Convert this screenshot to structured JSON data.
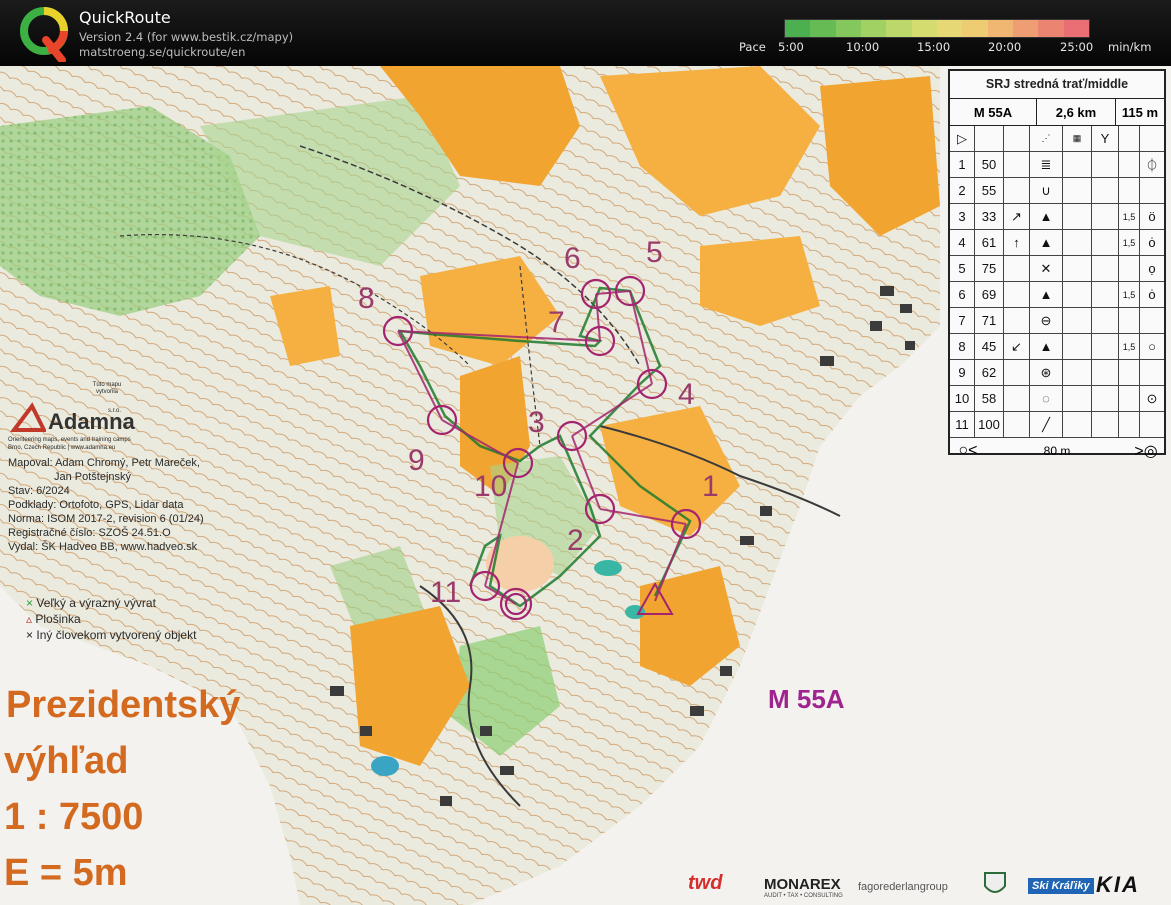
{
  "app": {
    "title": "QuickRoute",
    "version": "Version 2.4  (for www.bestik.cz/mapy)",
    "url": "matstroeng.se/quickroute/en"
  },
  "pace": {
    "label": "Pace",
    "ticks": [
      "5:00",
      "10:00",
      "15:00",
      "20:00",
      "25:00"
    ],
    "unit": "min/km"
  },
  "map": {
    "publisher_name": "Adamna",
    "publisher_small": "s.r.o.",
    "publisher_tag": "Orienteering maps, events and training camps",
    "publisher_addr": "Brno, Czech Republic | www.adamna.eu",
    "made_by_label": "Túto mapu vytvorila",
    "credits": [
      "Mapoval: Adam Chromý, Petr Mareček,",
      "Jan Potštejnský",
      "Stav: 6/2024",
      "Podklady: Ortofoto, GPS, Lidar data",
      "Norma: ISOM 2017-2, revision 6 (01/24)",
      "Registračné číslo: SZOŠ 24.51.O",
      "Vydal: ŠK Hadveo BB, www.hadveo.sk"
    ],
    "legend": [
      {
        "symbol": "×",
        "color": "#2e9e3a",
        "text": "Veľký a výrazný vývrat"
      },
      {
        "symbol": "▵",
        "color": "#c0392b",
        "text": "Plošinka"
      },
      {
        "symbol": "×",
        "color": "#222222",
        "text": "Iný človekom vytvorený objekt"
      }
    ],
    "title_line1": "Prezidentský",
    "title_line2": "výhľad",
    "scale": "1 : 7500",
    "equidistance": "E = 5m",
    "course_code": "M 55A",
    "control_numbers": [
      "1",
      "2",
      "3",
      "4",
      "5",
      "6",
      "7",
      "8",
      "9",
      "10",
      "11"
    ]
  },
  "description": {
    "event": "SRJ stredná trať/middle",
    "course": "M 55A",
    "length": "2,6 km",
    "climb": "115 m",
    "rows": [
      {
        "n": "1",
        "code": "50",
        "dir": "",
        "feat": "≣",
        "dim": "",
        "pos": "⏀"
      },
      {
        "n": "2",
        "code": "55",
        "dir": "",
        "feat": "∪",
        "dim": "",
        "pos": ""
      },
      {
        "n": "3",
        "code": "33",
        "dir": "↗",
        "feat": "▲",
        "dim": "1,5",
        "pos": "ö"
      },
      {
        "n": "4",
        "code": "61",
        "dir": "↑",
        "feat": "▲",
        "dim": "1,5",
        "pos": "ȯ"
      },
      {
        "n": "5",
        "code": "75",
        "dir": "",
        "feat": "✕",
        "dim": "",
        "pos": "ọ"
      },
      {
        "n": "6",
        "code": "69",
        "dir": "",
        "feat": "▲",
        "dim": "1,5",
        "pos": "ȯ"
      },
      {
        "n": "7",
        "code": "71",
        "dir": "",
        "feat": "⊖",
        "dim": "",
        "pos": ""
      },
      {
        "n": "8",
        "code": "45",
        "dir": "↙",
        "feat": "▲",
        "dim": "1,5",
        "pos": "○"
      },
      {
        "n": "9",
        "code": "62",
        "dir": "",
        "feat": "⊛",
        "dim": "",
        "pos": ""
      },
      {
        "n": "10",
        "code": "58",
        "dir": "",
        "feat": "◌",
        "dim": "",
        "pos": "⊙"
      },
      {
        "n": "11",
        "code": "100",
        "dir": "",
        "feat": "╱",
        "dim": "",
        "pos": ""
      }
    ],
    "finish_distance": "80 m"
  },
  "sponsors": [
    "twd",
    "MONAREX",
    "AUDIT • TAX • CONSULTING",
    "fagorederlangroup",
    "Ski Kráľiky",
    "KIA"
  ]
}
